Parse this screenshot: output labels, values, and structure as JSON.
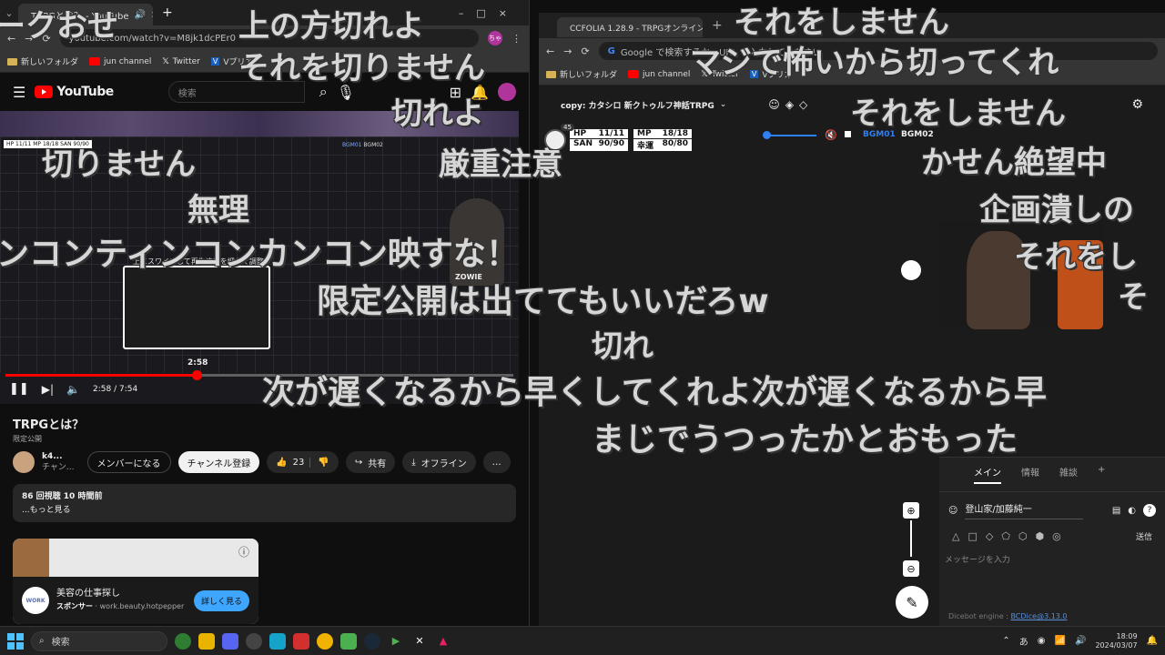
{
  "left_browser": {
    "tab_title": "TRPGとは？ - YouTube",
    "url": "youtube.com/watch?v=M8jk1dcPEr0",
    "bookmarks": [
      "新しいフォルダ",
      "jun channel",
      "Twitter",
      "Vプリカ"
    ],
    "search_placeholder": "検索",
    "logo_text": "YouTube",
    "avatar_text": "ちゃ"
  },
  "video": {
    "hover_tooltip": "上にスワイプして再生速度を細かく調整",
    "preview_time": "2:58",
    "time_display": "2:58 / 7:54",
    "progress": 0.376,
    "stream_logo": "ZOWIE",
    "bgm_labels": [
      "BGM01",
      "BGM02"
    ],
    "stat_small": "HP 11/11 MP 18/18 SAN 90/90"
  },
  "video_info": {
    "title": "TRPGとは？",
    "visibility": "限定公開",
    "channel_name": "k4...",
    "channel_sub": "チャン...",
    "member_button": "メンバーになる",
    "subscribe_button": "チャンネル登録",
    "like_count": "23",
    "share_label": "共有",
    "offline_label": "オフライン",
    "more_label": "…",
    "views_line": "86 回視聴  10 時間前",
    "more_text": "...もっと見る"
  },
  "ad": {
    "logo_text": "WORK",
    "title": "美容の仕事探し",
    "sponsor_label": "スポンサー",
    "sponsor_domain": "work.beauty.hotpepper",
    "cta": "詳しく見る"
  },
  "right_browser": {
    "tab_title": "CCFOLIA 1.28.9 - TRPGオンライン",
    "address_placeholder": "Google で検索するか、URL を入力してください",
    "bookmarks": [
      "新しいフォルダ",
      "jun channel",
      "Twitter",
      "Vプリカ"
    ]
  },
  "ccfolia": {
    "room_title": "copy: カタシロ 新クトゥルフ神話TRPG",
    "stat_badge": "45",
    "stats": [
      {
        "label": "HP",
        "value": "11/11"
      },
      {
        "label": "MP",
        "value": "18/18"
      },
      {
        "label": "SAN",
        "value": "90/90"
      },
      {
        "label": "幸運",
        "value": "80/80"
      }
    ],
    "bgm": [
      "BGM01",
      "BGM02"
    ],
    "chat_tabs": [
      "メイン",
      "情報",
      "雑談"
    ],
    "character_name": "登山家/加藤純一",
    "send_label": "送信",
    "message_placeholder": "メッセージを入力",
    "dicebot_label": "Dicebot engine :",
    "dicebot_version": "BCDice@3.13.0"
  },
  "taskbar": {
    "search_label": "検索",
    "ime": "あ",
    "time": "18:09",
    "date": "2024/03/07"
  },
  "danmaku": [
    "ークおせ",
    "上の方切れよ",
    "それをしません",
    "それを切りません",
    "マジで怖いから切ってくれ",
    "切れよ",
    "それをしません",
    "厳重注意",
    "切りません",
    "かせん絶望中",
    "無理",
    "企画潰しの",
    "ンコンティンコンカンコン映すな！",
    "それをし",
    "限定公開は出ててもいいだろw",
    "そ",
    "切れ",
    "次が遅くなるから早くしてくれよ次が遅くなるから早",
    "まじでうつったかとおもった"
  ],
  "colors": {
    "accent_red": "#ff0000",
    "link_blue": "#3ea6ff",
    "bgm_blue": "#2f7ff5"
  }
}
